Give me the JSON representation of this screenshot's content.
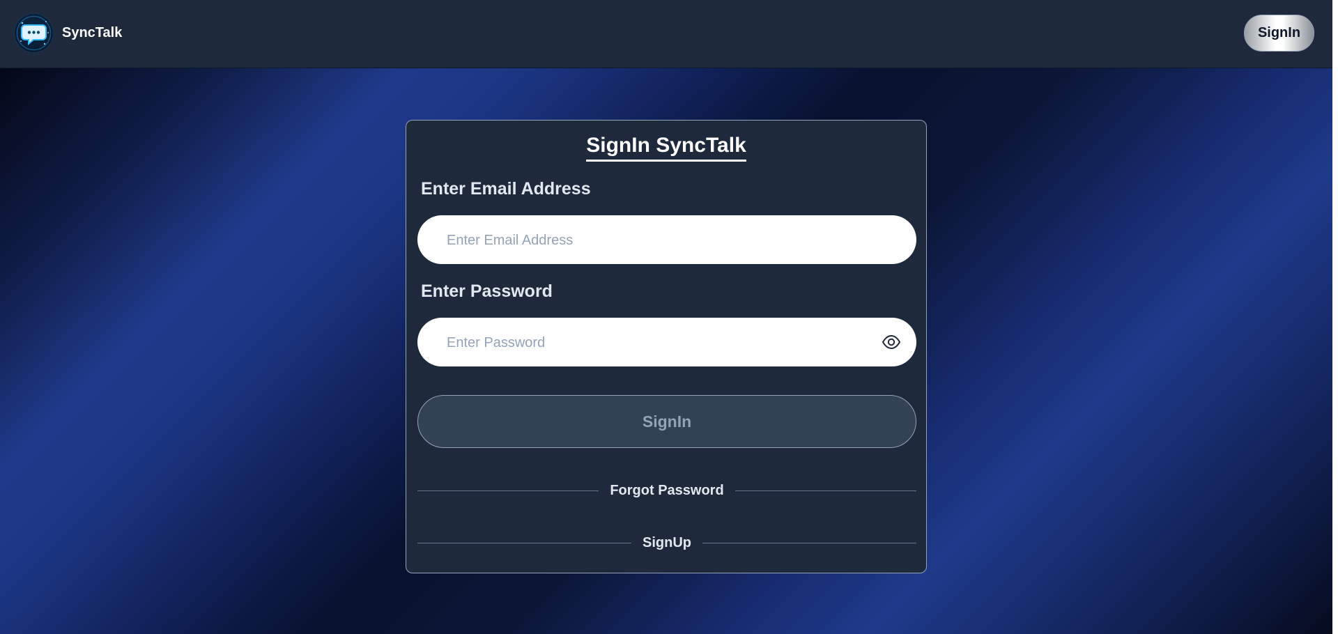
{
  "navbar": {
    "brand_name": "SyncTalk",
    "logo_icon": "chat-bubble-logo-icon",
    "signin_label": "SignIn"
  },
  "form": {
    "title": "SignIn SyncTalk",
    "email_label": "Enter Email Address",
    "email_placeholder": "Enter Email Address",
    "email_value": "",
    "password_label": "Enter Password",
    "password_placeholder": "Enter Password",
    "password_value": "",
    "password_toggle_icon": "eye-icon",
    "submit_label": "SignIn",
    "forgot_password_label": "Forgot Password",
    "signup_label": "SignUp"
  },
  "colors": {
    "navbar_bg": "#1e293b",
    "card_bg": "#1e293b",
    "card_border": "#94a3b8",
    "submit_bg": "#334155",
    "accent_blue": "#1f3a8a"
  }
}
